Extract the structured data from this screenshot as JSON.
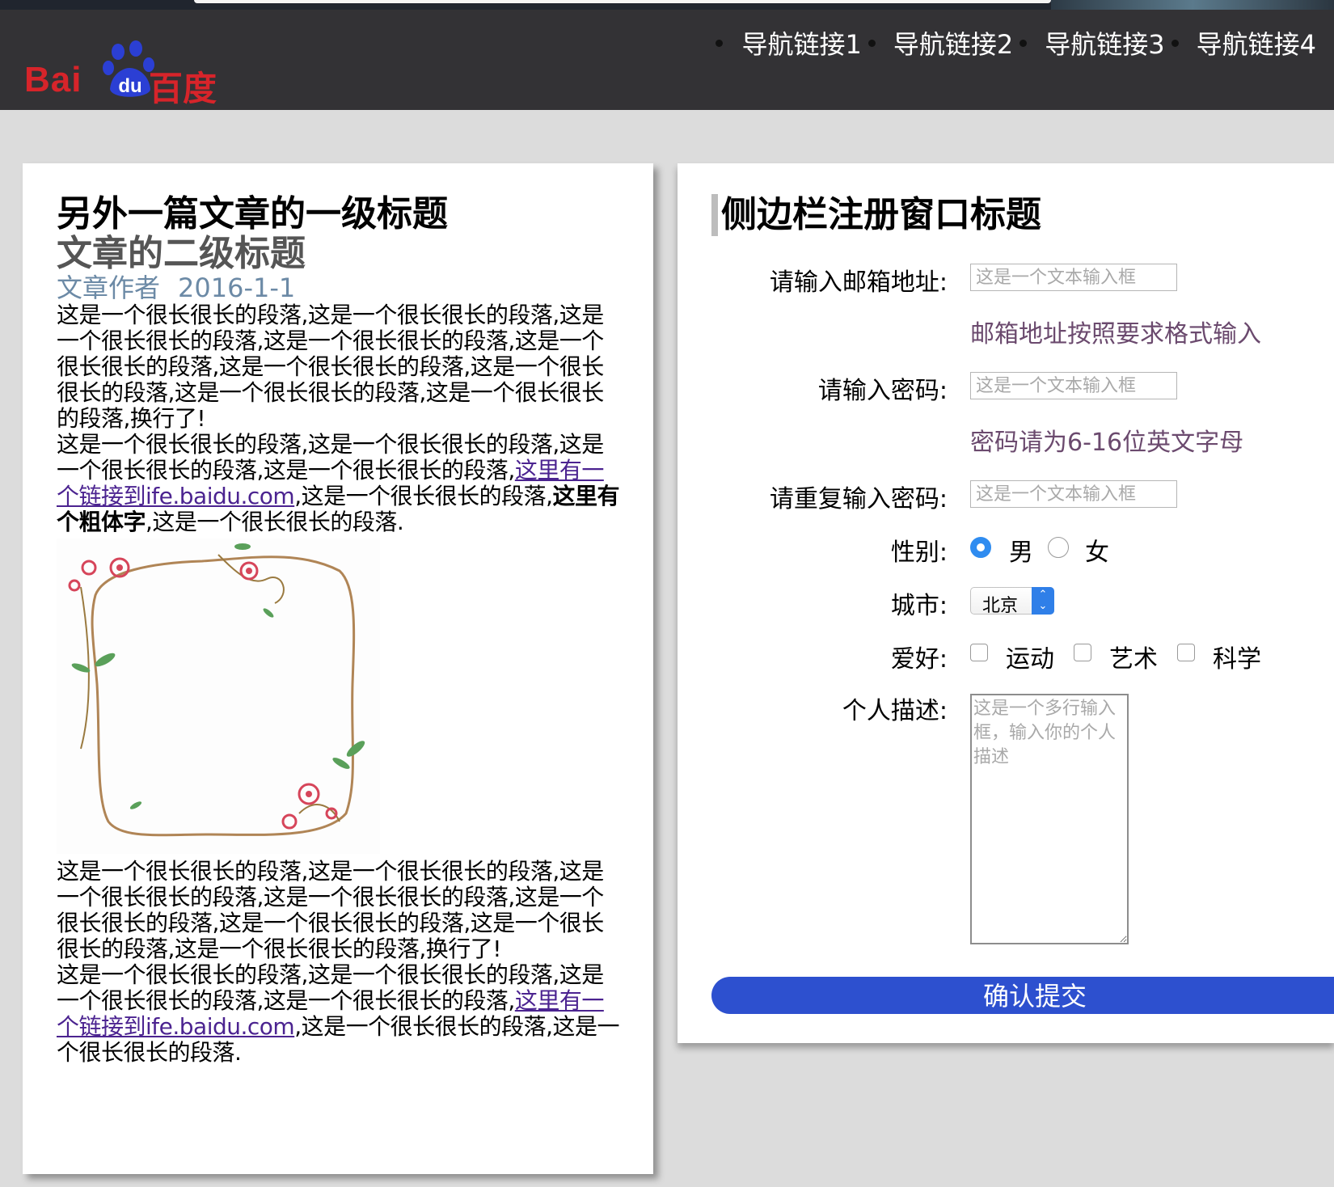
{
  "logo": {
    "latin": "Bai",
    "chinese": "百度",
    "paw_text": "du"
  },
  "nav": [
    {
      "label": "导航链接1"
    },
    {
      "label": "导航链接2"
    },
    {
      "label": "导航链接3"
    },
    {
      "label": "导航链接4"
    }
  ],
  "article": {
    "h1": "另外一篇文章的一级标题",
    "h2": "文章的二级标题",
    "author": "文章作者",
    "date": "2016-1-1",
    "p1": "这是一个很长很长的段落,这是一个很长很长的段落,这是一个很长很长的段落,这是一个很长很长的段落,这是一个很长很长的段落,这是一个很长很长的段落,这是一个很长很长的段落,这是一个很长很长的段落,这是一个很长很长的段落,换行了!",
    "p2_a": "这是一个很长很长的段落,这是一个很长很长的段落,这是一个很长很长的段落,这是一个很长很长的段落,",
    "link1": "这里有一个链接到ife.baidu.com",
    "p2_b": ",这是一个很长很长的段落,",
    "bold": "这里有个粗体字",
    "p2_c": ",这是一个很长很长的段落.",
    "p3": "这是一个很长很长的段落,这是一个很长很长的段落,这是一个很长很长的段落,这是一个很长很长的段落,这是一个很长很长的段落,这是一个很长很长的段落,这是一个很长很长的段落,这是一个很长很长的段落,换行了!",
    "p4_a": "这是一个很长很长的段落,这是一个很长很长的段落,这是一个很长很长的段落,这是一个很长很长的段落,",
    "link2": "这里有一个链接到ife.baidu.com",
    "p4_b": ",这是一个很长很长的段落,这是一个很长很长的段落."
  },
  "sidebar": {
    "title": "侧边栏注册窗口标题",
    "email_label": "请输入邮箱地址:",
    "email_placeholder": "这是一个文本输入框",
    "email_hint": "邮箱地址按照要求格式输入",
    "password_label": "请输入密码:",
    "password_placeholder": "这是一个文本输入框",
    "password_hint": "密码请为6-16位英文字母",
    "repeat_label": "请重复输入密码:",
    "repeat_placeholder": "这是一个文本输入框",
    "gender_label": "性别:",
    "gender_options": [
      "男",
      "女"
    ],
    "gender_selected": "男",
    "city_label": "城市:",
    "city_value": "北京",
    "hobby_label": "爱好:",
    "hobby_options": [
      "运动",
      "艺术",
      "科学"
    ],
    "desc_label": "个人描述:",
    "desc_placeholder": "这是一个多行输入框，输入你的个人描述",
    "submit_label": "确认提交"
  },
  "colors": {
    "header_bg": "#333235",
    "page_bg": "#dcdcdc",
    "submit_bg": "#2d50cf",
    "link": "#4b2390",
    "hint": "#6b4a6e",
    "meta": "#6c8aa6",
    "logo_red": "#d7242a",
    "logo_blue": "#2b3fd4"
  }
}
